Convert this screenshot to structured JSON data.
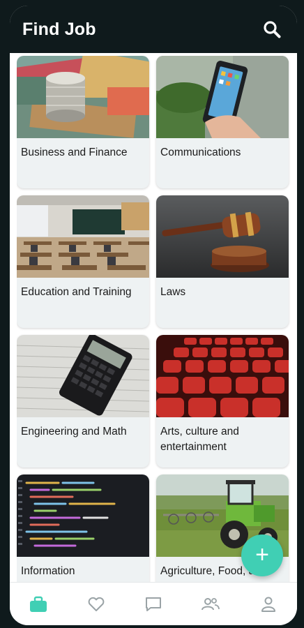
{
  "header": {
    "title": "Find Job"
  },
  "categories": [
    {
      "label": "Business and Finance",
      "image": "stacked-coins-on-banknotes"
    },
    {
      "label": "Communications",
      "image": "hand-holding-smartphone"
    },
    {
      "label": "Education and Training",
      "image": "classroom"
    },
    {
      "label": "Laws",
      "image": "judge-gavel"
    },
    {
      "label": "Engineering and Math",
      "image": "calculator-on-papers"
    },
    {
      "label": "Arts, culture and entertainment",
      "image": "red-theater-seats"
    },
    {
      "label": "Information",
      "image": "code-on-screen"
    },
    {
      "label": "Agriculture, Food, and",
      "image": "green-tractor-in-field"
    }
  ],
  "fab": {
    "label": "+"
  },
  "bottom_nav": {
    "items": [
      {
        "icon": "briefcase-icon",
        "active": true
      },
      {
        "icon": "heart-icon",
        "active": false
      },
      {
        "icon": "chat-icon",
        "active": false
      },
      {
        "icon": "people-icon",
        "active": false
      },
      {
        "icon": "person-icon",
        "active": false
      }
    ]
  },
  "colors": {
    "accent": "#40cfb4",
    "header_bg": "#0f1a1c",
    "card_bg": "#eef2f3",
    "inactive_icon": "#9aa3a6"
  }
}
